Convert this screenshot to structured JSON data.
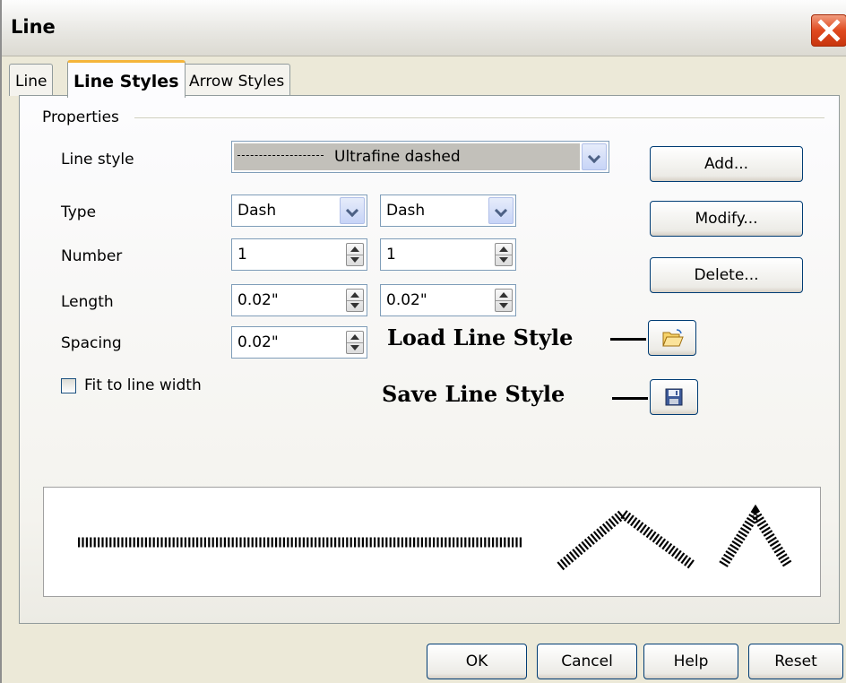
{
  "window": {
    "title": "Line"
  },
  "tabs": [
    {
      "label": "Line",
      "active": false
    },
    {
      "label": "Line Styles",
      "active": true
    },
    {
      "label": "Arrow Styles",
      "active": false
    }
  ],
  "properties": {
    "group_label": "Properties",
    "line_style_label": "Line style",
    "line_style_value": "Ultrafine dashed",
    "type_label": "Type",
    "type_value_1": "Dash",
    "type_value_2": "Dash",
    "number_label": "Number",
    "number_value_1": "1",
    "number_value_2": "1",
    "length_label": "Length",
    "length_value_1": "0.02\"",
    "length_value_2": "0.02\"",
    "spacing_label": "Spacing",
    "spacing_value": "0.02\"",
    "fit_label": "Fit to line width",
    "fit_checked": false
  },
  "side_buttons": {
    "add": "Add...",
    "modify": "Modify...",
    "delete": "Delete..."
  },
  "annotations": {
    "load": "Load Line Style",
    "save": "Save Line Style"
  },
  "icons": {
    "load": "folder-open-icon",
    "save": "floppy-disk-icon",
    "close": "close-icon"
  },
  "footer": {
    "ok": "OK",
    "cancel": "Cancel",
    "help": "Help",
    "reset": "Reset"
  },
  "colors": {
    "close_button": "#e04a1f",
    "active_tab_accent": "#f5b53a"
  }
}
